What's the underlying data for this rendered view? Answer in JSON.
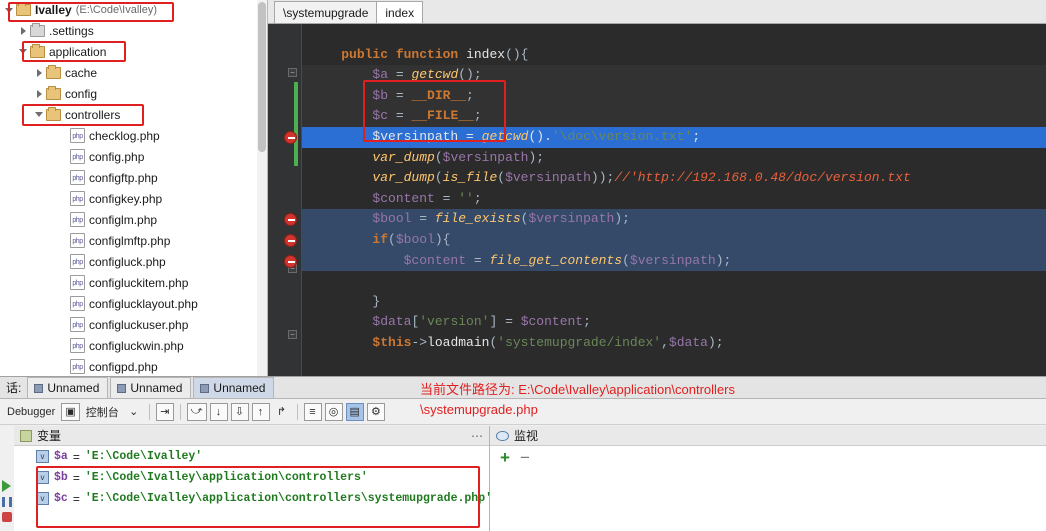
{
  "project_tree": {
    "root": {
      "label": "Ivalley",
      "path": "(E:\\Code\\Ivalley)"
    },
    "items": [
      {
        "label": ".settings",
        "type": "folder-src",
        "indent": 1,
        "arrow": "right",
        "highlight": false
      },
      {
        "label": "application",
        "type": "folder",
        "indent": 1,
        "arrow": "down",
        "highlight": true
      },
      {
        "label": "cache",
        "type": "folder",
        "indent": 2,
        "arrow": "right",
        "highlight": false
      },
      {
        "label": "config",
        "type": "folder",
        "indent": 2,
        "arrow": "right",
        "highlight": false
      },
      {
        "label": "controllers",
        "type": "folder",
        "indent": 2,
        "arrow": "down",
        "highlight": true
      },
      {
        "label": "checklog.php",
        "type": "php",
        "indent": 4,
        "arrow": "",
        "highlight": false
      },
      {
        "label": "config.php",
        "type": "php",
        "indent": 4,
        "arrow": "",
        "highlight": false
      },
      {
        "label": "configftp.php",
        "type": "php",
        "indent": 4,
        "arrow": "",
        "highlight": false
      },
      {
        "label": "configkey.php",
        "type": "php",
        "indent": 4,
        "arrow": "",
        "highlight": false
      },
      {
        "label": "configlm.php",
        "type": "php",
        "indent": 4,
        "arrow": "",
        "highlight": false
      },
      {
        "label": "configlmftp.php",
        "type": "php",
        "indent": 4,
        "arrow": "",
        "highlight": false
      },
      {
        "label": "configluck.php",
        "type": "php",
        "indent": 4,
        "arrow": "",
        "highlight": false
      },
      {
        "label": "configluckitem.php",
        "type": "php",
        "indent": 4,
        "arrow": "",
        "highlight": false
      },
      {
        "label": "configlucklayout.php",
        "type": "php",
        "indent": 4,
        "arrow": "",
        "highlight": false
      },
      {
        "label": "configluckuser.php",
        "type": "php",
        "indent": 4,
        "arrow": "",
        "highlight": false
      },
      {
        "label": "configluckwin.php",
        "type": "php",
        "indent": 4,
        "arrow": "",
        "highlight": false
      },
      {
        "label": "configpd.php",
        "type": "php",
        "indent": 4,
        "arrow": "",
        "highlight": false
      }
    ],
    "php_icon_text": "php"
  },
  "editor": {
    "tabs": [
      {
        "label": "\\systemupgrade",
        "active": false
      },
      {
        "label": "index",
        "active": true
      }
    ],
    "code_lines": [
      {
        "n": 1,
        "style": "plain",
        "segments": []
      },
      {
        "n": 2,
        "style": "plain",
        "segments": [
          {
            "t": "    ",
            "c": "plain"
          },
          {
            "t": "public function",
            "c": "kw"
          },
          {
            "t": " ",
            "c": "plain"
          },
          {
            "t": "index",
            "c": "white"
          },
          {
            "t": "(){",
            "c": "plain"
          }
        ]
      },
      {
        "n": 3,
        "style": "dark",
        "segments": [
          {
            "t": "        ",
            "c": "plain"
          },
          {
            "t": "$a",
            "c": "var"
          },
          {
            "t": " = ",
            "c": "plain"
          },
          {
            "t": "getcwd",
            "c": "fn"
          },
          {
            "t": "();",
            "c": "plain"
          }
        ]
      },
      {
        "n": 4,
        "style": "dark",
        "segments": [
          {
            "t": "        ",
            "c": "plain"
          },
          {
            "t": "$b",
            "c": "var"
          },
          {
            "t": " = ",
            "c": "plain"
          },
          {
            "t": "__DIR__",
            "c": "kw"
          },
          {
            "t": ";",
            "c": "plain"
          }
        ]
      },
      {
        "n": 5,
        "style": "dark",
        "segments": [
          {
            "t": "        ",
            "c": "plain"
          },
          {
            "t": "$c",
            "c": "var"
          },
          {
            "t": " = ",
            "c": "plain"
          },
          {
            "t": "__FILE__",
            "c": "kw"
          },
          {
            "t": ";",
            "c": "plain"
          }
        ]
      },
      {
        "n": 6,
        "style": "hl",
        "segments": [
          {
            "t": "        ",
            "c": "plain"
          },
          {
            "t": "$versinpath",
            "c": "white"
          },
          {
            "t": " = ",
            "c": "white"
          },
          {
            "t": "getcwd",
            "c": "fn"
          },
          {
            "t": "().",
            "c": "white"
          },
          {
            "t": "'\\doc\\version.txt'",
            "c": "str"
          },
          {
            "t": ";",
            "c": "white"
          }
        ]
      },
      {
        "n": 7,
        "style": "plain",
        "segments": [
          {
            "t": "        ",
            "c": "plain"
          },
          {
            "t": "var_dump",
            "c": "fn"
          },
          {
            "t": "(",
            "c": "plain"
          },
          {
            "t": "$versinpath",
            "c": "var"
          },
          {
            "t": ");",
            "c": "plain"
          }
        ]
      },
      {
        "n": 8,
        "style": "plain",
        "segments": [
          {
            "t": "        ",
            "c": "plain"
          },
          {
            "t": "var_dump",
            "c": "fn"
          },
          {
            "t": "(",
            "c": "plain"
          },
          {
            "t": "is_file",
            "c": "fn"
          },
          {
            "t": "(",
            "c": "plain"
          },
          {
            "t": "$versinpath",
            "c": "var"
          },
          {
            "t": "));",
            "c": "plain"
          },
          {
            "t": "//'http://192.168.0.48/doc/version.txt",
            "c": "cmt2"
          }
        ]
      },
      {
        "n": 9,
        "style": "plain",
        "segments": [
          {
            "t": "        ",
            "c": "plain"
          },
          {
            "t": "$content",
            "c": "var"
          },
          {
            "t": " = ",
            "c": "plain"
          },
          {
            "t": "''",
            "c": "str"
          },
          {
            "t": ";",
            "c": "plain"
          }
        ]
      },
      {
        "n": 10,
        "style": "sel",
        "segments": [
          {
            "t": "        ",
            "c": "plain"
          },
          {
            "t": "$bool",
            "c": "var"
          },
          {
            "t": " = ",
            "c": "plain"
          },
          {
            "t": "file_exists",
            "c": "fn"
          },
          {
            "t": "(",
            "c": "plain"
          },
          {
            "t": "$versinpath",
            "c": "var"
          },
          {
            "t": ");",
            "c": "plain"
          }
        ]
      },
      {
        "n": 11,
        "style": "sel",
        "segments": [
          {
            "t": "        ",
            "c": "plain"
          },
          {
            "t": "if",
            "c": "kw"
          },
          {
            "t": "(",
            "c": "plain"
          },
          {
            "t": "$bool",
            "c": "var"
          },
          {
            "t": "){",
            "c": "plain"
          }
        ]
      },
      {
        "n": 12,
        "style": "sel",
        "segments": [
          {
            "t": "            ",
            "c": "plain"
          },
          {
            "t": "$content",
            "c": "var"
          },
          {
            "t": " = ",
            "c": "plain"
          },
          {
            "t": "file_get_contents",
            "c": "fn"
          },
          {
            "t": "(",
            "c": "plain"
          },
          {
            "t": "$versinpath",
            "c": "var"
          },
          {
            "t": ");",
            "c": "plain"
          }
        ]
      },
      {
        "n": 13,
        "style": "plain",
        "segments": []
      },
      {
        "n": 14,
        "style": "plain",
        "segments": [
          {
            "t": "        }",
            "c": "plain"
          }
        ]
      },
      {
        "n": 15,
        "style": "plain",
        "segments": [
          {
            "t": "        ",
            "c": "plain"
          },
          {
            "t": "$data",
            "c": "var"
          },
          {
            "t": "[",
            "c": "plain"
          },
          {
            "t": "'version'",
            "c": "str"
          },
          {
            "t": "] = ",
            "c": "plain"
          },
          {
            "t": "$content",
            "c": "var"
          },
          {
            "t": ";",
            "c": "plain"
          }
        ]
      },
      {
        "n": 16,
        "style": "plain",
        "segments": [
          {
            "t": "        ",
            "c": "plain"
          },
          {
            "t": "$this",
            "c": "kw"
          },
          {
            "t": "->",
            "c": "plain"
          },
          {
            "t": "loadmain",
            "c": "white"
          },
          {
            "t": "(",
            "c": "plain"
          },
          {
            "t": "'systemupgrade/index'",
            "c": "str"
          },
          {
            "t": ",",
            "c": "plain"
          },
          {
            "t": "$data",
            "c": "var"
          },
          {
            "t": ");",
            "c": "plain"
          }
        ]
      }
    ],
    "breakpoint_lines": [
      6,
      10,
      11,
      12
    ]
  },
  "annotation": {
    "line1": "当前文件路径为: E:\\Code\\Ivalley\\application\\controllers",
    "line2": "\\systemupgrade.php"
  },
  "debug": {
    "session_label": "话:",
    "session_tabs": [
      {
        "label": "Unnamed",
        "active": false
      },
      {
        "label": "Unnamed",
        "active": false
      },
      {
        "label": "Unnamed",
        "active": true
      }
    ],
    "toolbar": {
      "debugger_label": "Debugger",
      "console_label": "控制台",
      "buttons": [
        "step-over-icon",
        "step-into-icon",
        "force-step-into-icon",
        "step-out-icon",
        "run-to-cursor-icon",
        "evaluate-icon",
        "mute-breakpoints-icon",
        "view-breakpoints-icon",
        "settings-icon"
      ]
    },
    "variables_pane": {
      "title": "变量",
      "rows": [
        {
          "name": "$a",
          "value": "'E:\\Code\\Ivalley'"
        },
        {
          "name": "$b",
          "value": "'E:\\Code\\Ivalley\\application\\controllers'"
        },
        {
          "name": "$c",
          "value": "'E:\\Code\\Ivalley\\application\\controllers\\systemupgrade.php'"
        }
      ]
    },
    "watch_pane": {
      "title": "监视",
      "add_label": "+",
      "remove_label": "−"
    }
  },
  "colors": {
    "accent_red": "#e02020",
    "editor_bg": "#2b2b2b",
    "highlight_line": "#2b6fd4",
    "selection": "#344a68",
    "string_green": "#6a8759",
    "keyword_orange": "#cc7832",
    "variable_purple": "#9876aa",
    "function_yellow": "#ffc66d",
    "value_green": "#1f7a1f"
  }
}
